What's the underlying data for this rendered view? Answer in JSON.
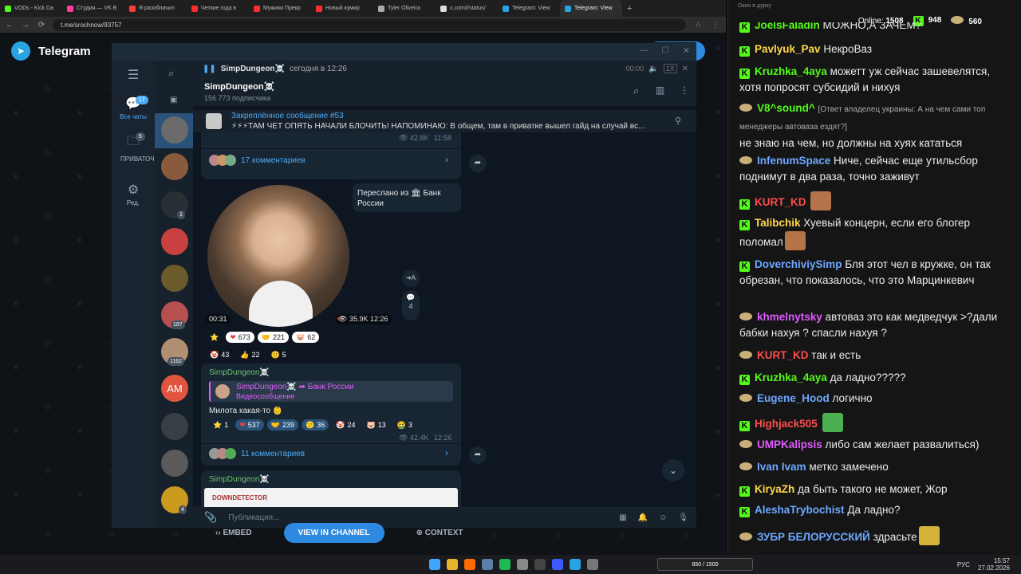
{
  "browser": {
    "tabs": [
      {
        "label": "VODs - Kick Da",
        "color": "#53fc18"
      },
      {
        "label": "Студия — VK В",
        "color": "#ff3ba0"
      },
      {
        "label": "Я разоблачил",
        "color": "#ff3b3b"
      },
      {
        "label": "Четкие года в",
        "color": "#ff2d2d"
      },
      {
        "label": "Мужики Прекр",
        "color": "#ff2d2d"
      },
      {
        "label": "Новый кумир",
        "color": "#ff2d2d"
      },
      {
        "label": "Tyler Oliveira",
        "color": "#aaaaaa"
      },
      {
        "label": "x.com/i/status/",
        "color": "#dddddd"
      },
      {
        "label": "Telegram: View",
        "color": "#2aa3e3"
      },
      {
        "label": "Telegram: View",
        "color": "#2aa3e3"
      }
    ],
    "url": "t.me/srochnow/93757"
  },
  "page": {
    "brand": "Telegram",
    "embed_label": "EMBED",
    "view_in_channel": "VIEW IN CHANNEL",
    "context_label": "CONTEXT"
  },
  "telegram": {
    "left_menu": [
      {
        "label": "Все чаты",
        "badge": "17",
        "icon": "chat-bubbles-icon"
      },
      {
        "label": "ПРИВАТОЧКА",
        "badge": "5",
        "icon": "folder-icon"
      },
      {
        "label": "Ред.",
        "badge": "",
        "icon": "sliders-icon"
      }
    ],
    "chat_badges": [
      "1",
      "187",
      "1162",
      "1",
      "4"
    ],
    "chat_avatar_initials": "AM",
    "player": {
      "title": "SimpDungeon☠️",
      "time_info": "сегодня в 12:26",
      "timecode": "00:00",
      "speed": "1X"
    },
    "channel": {
      "name": "SimpDungeon☠️",
      "subscribers": "156 773 подписчика"
    },
    "pinned": {
      "title": "Закреплённое сообщение #53",
      "text": "⚡⚡⚡ТАМ ЧЕТ ОПЯТЬ НАЧАЛИ БЛОЧИТЬ! НАПОМИНАЮ:  В общем, там в приватке вышел гайд на случай вс..."
    },
    "msg1": {
      "views": "42.8K",
      "time": "11:58",
      "comments": "17 комментариев"
    },
    "video_msg": {
      "forwarded_from": "Переслано из 🏛 Банк России",
      "duration": "00:31",
      "views": "35.9K",
      "time": "12:26",
      "comment_count": "4",
      "reactions": [
        {
          "emoji": "⭐",
          "count": ""
        },
        {
          "emoji": "❤",
          "count": "673"
        },
        {
          "emoji": "🤝",
          "count": "221"
        },
        {
          "emoji": "🐷",
          "count": "62"
        },
        {
          "emoji": "🤡",
          "count": "43"
        },
        {
          "emoji": "👍",
          "count": "22"
        },
        {
          "emoji": "🙂",
          "count": "5"
        }
      ]
    },
    "msg3": {
      "sender": "SimpDungeon☠️",
      "reply_name": "SimpDungeon☠️ ➦ Банк России",
      "reply_type": "Видеосообщение",
      "text": "Милота какая-то 👶",
      "reactions": [
        {
          "emoji": "⭐",
          "count": "1"
        },
        {
          "emoji": "❤",
          "count": "537"
        },
        {
          "emoji": "🤝",
          "count": "239"
        },
        {
          "emoji": "🙂",
          "count": "36"
        },
        {
          "emoji": "🤡",
          "count": "24"
        },
        {
          "emoji": "🐷",
          "count": "13"
        },
        {
          "emoji": "🤮",
          "count": "3"
        }
      ],
      "views": "42.4K",
      "time": "12:26",
      "comments": "11 комментариев"
    },
    "msg4": {
      "sender": "SimpDungeon☠️",
      "preview": "DOWNDETECTOR"
    },
    "composer_placeholder": "Публикация..."
  },
  "chat_overlay": {
    "window_title": "Окно в дурку",
    "online_label": "Online:",
    "online": "1508",
    "kick_count": "948",
    "other_count": "560",
    "messages": [
      {
        "platform": "kick",
        "user": "JoelsFaladin",
        "color": "#53fc18",
        "text": "МОЖНО,А ЗАЧЕМ?"
      },
      {
        "platform": "kick",
        "user": "Pavlyuk_Pav",
        "color": "#ffd84d",
        "text": "НекроВаз"
      },
      {
        "platform": "kick",
        "user": "Kruzhka_4aya",
        "color": "#53fc18",
        "text": "можетт уж сейчас зашевелятся, хотя попросят субсидий и нихуя"
      },
      {
        "platform": "other",
        "user": "V8^sound^",
        "color": "#53fc18",
        "reply": "[Ответ владелец украины: А на чем сами топ менеджеры автоваза ездят?]",
        "text": "не знаю на чем, но должны на хуях кататься"
      },
      {
        "platform": "other",
        "user": "InfenumSpace",
        "color": "#6ea8ff",
        "text": "Ниче, сейчас еще утильсбор поднимут в два раза, точно заживут"
      },
      {
        "platform": "kick",
        "user": "KURT_KD",
        "color": "#ff4d4d",
        "text": ""
      },
      {
        "platform": "kick",
        "user": "Talibchik",
        "color": "#ffd84d",
        "text": "Хуевый концерн, если его блогер поломал"
      },
      {
        "platform": "kick",
        "user": "DoverchiviySimp",
        "color": "#6ea8ff",
        "text": "Бля этот чел в кружке, он так обрезан, что показалось, что это Марцинкевич"
      },
      {
        "platform": "other",
        "user": "khmelnytsky",
        "color": "#e05cff",
        "text": "автоваз это как медведчук >?дали бабки нахуя ? спасли нахуя ?"
      },
      {
        "platform": "other",
        "user": "KURT_KD",
        "color": "#ff4d4d",
        "text": "так и есть"
      },
      {
        "platform": "kick",
        "user": "Kruzhka_4aya",
        "color": "#53fc18",
        "text": "да ладно?????"
      },
      {
        "platform": "other",
        "user": "Eugene_Hood",
        "color": "#6ea8ff",
        "text": "логично"
      },
      {
        "platform": "kick",
        "user": "Highjack505",
        "color": "#ff4d4d",
        "text": ""
      },
      {
        "platform": "other",
        "user": "UMPKalipsis",
        "color": "#e05cff",
        "text": "либо сам желает развалиться)"
      },
      {
        "platform": "other",
        "user": "Ivan Ivam",
        "color": "#6ea8ff",
        "text": "метко замечено"
      },
      {
        "platform": "kick",
        "user": "KiryaZh",
        "color": "#ffd84d",
        "text": "да быть такого не может, Жор"
      },
      {
        "platform": "kick",
        "user": "AleshaTrybochist",
        "color": "#6ea8ff",
        "text": "Да ладно?"
      },
      {
        "platform": "other",
        "user": "ЗУБР БЕЛОРУССКИЙ",
        "color": "#6ea8ff",
        "text": "здрасьте"
      }
    ]
  },
  "taskbar": {
    "widget": "850 / 1500",
    "lang": "РУС",
    "time": "15:57",
    "date": "27.02.2026"
  }
}
